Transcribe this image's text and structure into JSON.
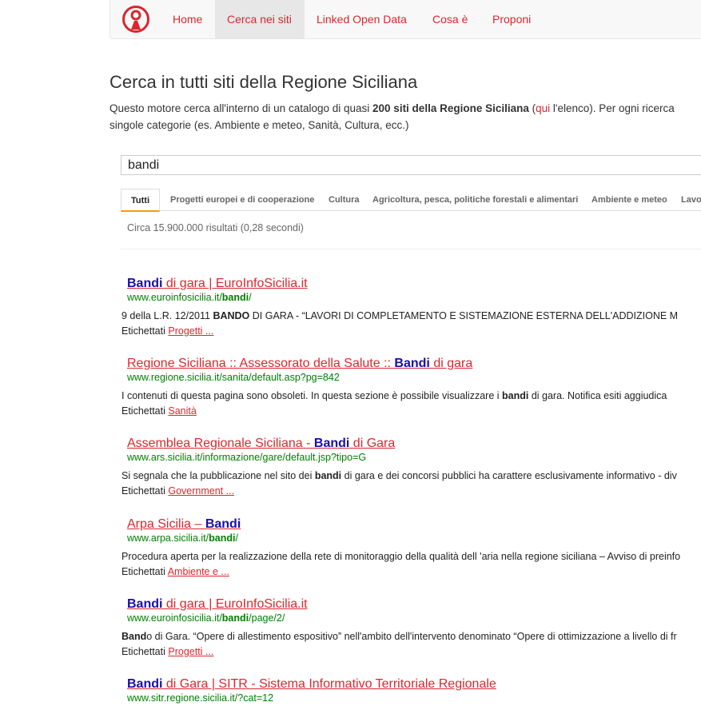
{
  "nav": {
    "items": [
      "Home",
      "Cerca nei siti",
      "Linked Open Data",
      "Cosa è",
      "Proponi"
    ],
    "active_index": 1
  },
  "page": {
    "title": "Cerca in tutti siti della Regione Siciliana",
    "intro_1a": "Questo motore cerca all'interno di un catalogo di quasi ",
    "intro_1b": "200 siti della Regione Siciliana",
    "intro_1c": " (",
    "intro_link": "qui",
    "intro_1d": " l'elenco). Per ogni ricerca",
    "intro_2": "singole categorie (es. Ambiente e meteo, Sanità, Cultura, ecc.)"
  },
  "search": {
    "value": "bandi"
  },
  "tabs": [
    "Tutti",
    "Progetti europei e di cooperazione",
    "Cultura",
    "Agricoltura, pesca, politiche forestali e alimentari",
    "Ambiente e meteo",
    "Lavor"
  ],
  "result_info": "Circa 15.900.000 risultati (0,28 secondi)",
  "label_prefix": "Etichettati ",
  "results": [
    {
      "title_pre": "",
      "title_bold": "Bandi",
      "title_post": " di gara | EuroInfoSicilia.it",
      "url_pre": "www.euroinfosicilia.it/",
      "url_bold": "bandi",
      "url_post": "/",
      "snip_pre": "9 della L.R. 12/2011 ",
      "snip_bold": "BANDO",
      "snip_post": " DI GARA - “LAVORI DI COMPLETAMENTO E SISTEMAZIONE ESTERNA DELL'ADDIZIONE M",
      "label": "Progetti ..."
    },
    {
      "title_pre": "Regione Siciliana :: Assessorato della Salute :: ",
      "title_bold": "Bandi",
      "title_post": " di gara",
      "url_pre": "www.regione.sicilia.it/sanita/default.asp?pg=842",
      "url_bold": "",
      "url_post": "",
      "snip_pre": "I contenuti di questa pagina sono obsoleti. In questa sezione è possibile visualizzare i ",
      "snip_bold": "bandi",
      "snip_post": " di gara. Notifica esiti aggiudica",
      "label": "Sanità"
    },
    {
      "title_pre": "Assemblea Regionale Siciliana - ",
      "title_bold": "Bandi",
      "title_post": " di Gara",
      "url_pre": "www.ars.sicilia.it/informazione/gare/default.jsp?tipo=G",
      "url_bold": "",
      "url_post": "",
      "snip_pre": "Si segnala che la pubblicazione nel sito dei ",
      "snip_bold": "bandi",
      "snip_post": " di gara e dei concorsi pubblici ha carattere esclusivamente informativo - div",
      "label": "Government ..."
    },
    {
      "title_pre": "Arpa Sicilia – ",
      "title_bold": "Bandi",
      "title_post": "",
      "url_pre": "www.arpa.sicilia.it/",
      "url_bold": "bandi",
      "url_post": "/",
      "snip_pre": "Procedura aperta per la realizzazione della rete di monitoraggio della qualità dell 'aria nella regione siciliana – Avviso di preinfo",
      "snip_bold": "",
      "snip_post": "",
      "label": "Ambiente e ..."
    },
    {
      "title_pre": "",
      "title_bold": "Bandi",
      "title_post": " di gara | EuroInfoSicilia.it",
      "url_pre": "www.euroinfosicilia.it/",
      "url_bold": "bandi",
      "url_post": "/page/2/",
      "snip_pre": "",
      "snip_bold": "Band",
      "snip_post": "o di Gara. “Opere di allestimento espositivo” nell'ambito dell'intervento denominato “Opere di ottimizzazione a livello di fr",
      "label": "Progetti ..."
    },
    {
      "title_pre": "",
      "title_bold": "Bandi",
      "title_post": " di Gara | SITR - Sistema Informativo Territoriale Regionale",
      "url_pre": "www.sitr.regione.sicilia.it/?cat=12",
      "url_bold": "",
      "url_post": "",
      "snip_pre": "",
      "snip_bold": "",
      "snip_post": "",
      "label": ""
    }
  ]
}
